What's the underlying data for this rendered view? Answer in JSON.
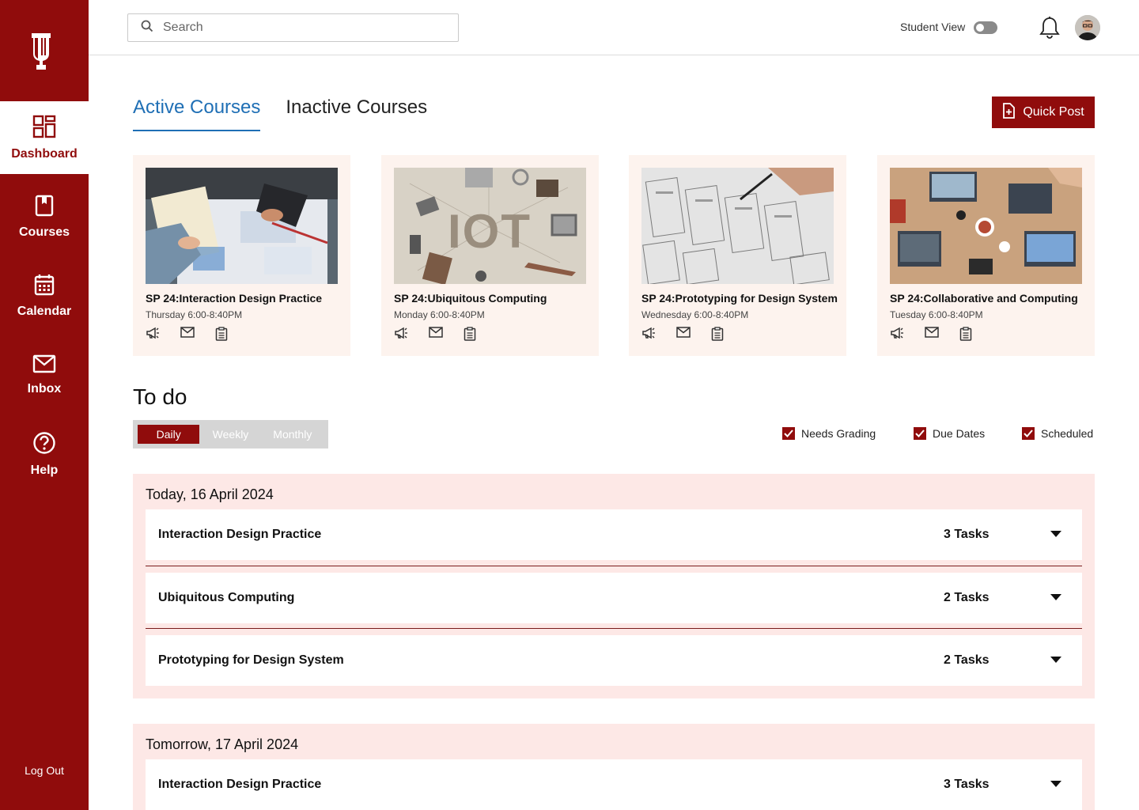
{
  "sidebar": {
    "items": [
      {
        "label": "Dashboard",
        "icon": "dashboard-icon"
      },
      {
        "label": "Courses",
        "icon": "book-icon"
      },
      {
        "label": "Calendar",
        "icon": "calendar-icon"
      },
      {
        "label": "Inbox",
        "icon": "mail-icon"
      },
      {
        "label": "Help",
        "icon": "help-icon"
      }
    ],
    "logout_label": "Log Out"
  },
  "header": {
    "search_placeholder": "Search",
    "student_view_label": "Student View"
  },
  "tabs": [
    {
      "label": "Active Courses",
      "active": true
    },
    {
      "label": "Inactive Courses",
      "active": false
    }
  ],
  "quick_post_label": "Quick Post",
  "courses": [
    {
      "title": "SP 24:Interaction Design Practice",
      "time": "Thursday 6:00-8:40PM"
    },
    {
      "title": "SP 24:Ubiquitous Computing",
      "time": "Monday 6:00-8:40PM",
      "image_text": "IOT"
    },
    {
      "title": "SP 24:Prototyping for Design System",
      "time": "Wednesday 6:00-8:40PM"
    },
    {
      "title": "SP 24:Collaborative and Computing",
      "time": "Tuesday 6:00-8:40PM"
    }
  ],
  "todo": {
    "title": "To do",
    "views": [
      "Daily",
      "Weekly",
      "Monthly"
    ],
    "active_view": "Daily",
    "filters": [
      {
        "label": "Needs Grading",
        "checked": true
      },
      {
        "label": "Due Dates",
        "checked": true
      },
      {
        "label": "Scheduled",
        "checked": true
      }
    ],
    "days": [
      {
        "title": "Today, 16 April 2024",
        "tasks": [
          {
            "course": "Interaction Design Practice",
            "count": "3 Tasks"
          },
          {
            "course": "Ubiquitous Computing",
            "count": "2 Tasks"
          },
          {
            "course": "Prototyping for Design System",
            "count": "2 Tasks"
          }
        ]
      },
      {
        "title": "Tomorrow, 17 April 2024",
        "tasks": [
          {
            "course": "Interaction Design Practice",
            "count": "3 Tasks"
          }
        ]
      }
    ]
  },
  "colors": {
    "brand": "#900c0c",
    "accent": "#1f6fb5",
    "card_bg": "#fdf3ee",
    "todo_bg": "#fde8e6"
  }
}
